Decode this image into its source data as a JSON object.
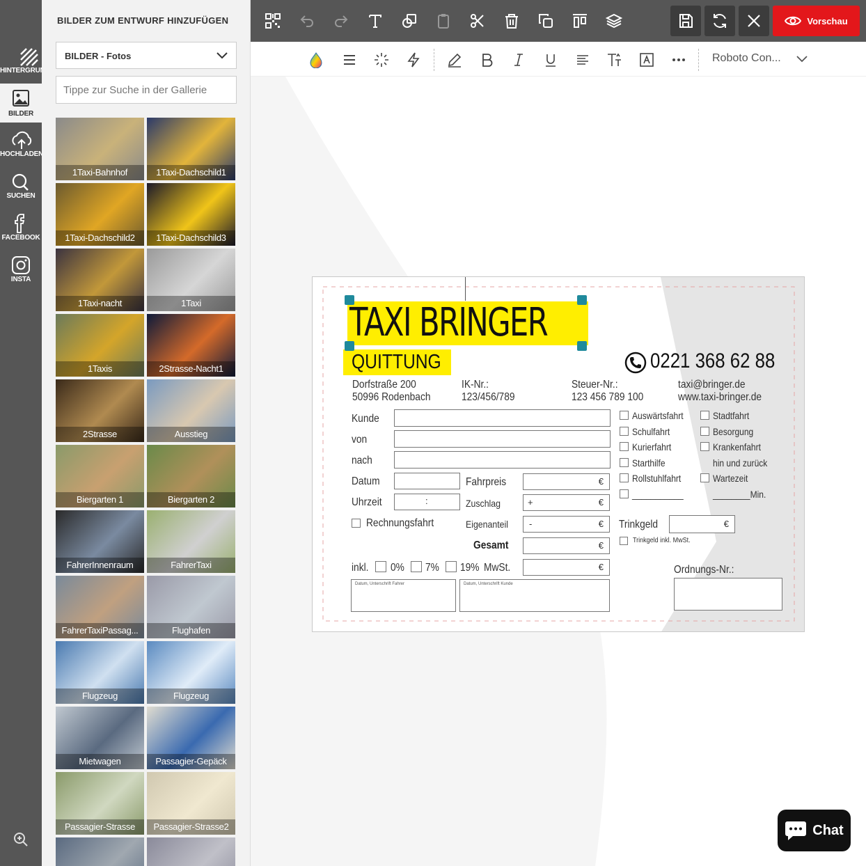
{
  "rail": {
    "items": [
      {
        "label": "HINTERGRUND",
        "icon": "background-stripes-icon"
      },
      {
        "label": "BILDER",
        "icon": "image-icon"
      },
      {
        "label": "HOCHLADEN",
        "icon": "cloud-upload-icon"
      },
      {
        "label": "SUCHEN",
        "icon": "search-icon"
      },
      {
        "label": "FACEBOOK",
        "icon": "facebook-icon"
      },
      {
        "label": "INSTA",
        "icon": "instagram-icon"
      }
    ]
  },
  "panel": {
    "title": "BILDER ZUM ENTWURF HINZUFÜGEN",
    "category_select": "BILDER - Fotos",
    "search_placeholder": "Tippe zur Suche in der Gallerie",
    "thumbnails": [
      "1Taxi-Bahnhof",
      "1Taxi-Dachschild1",
      "1Taxi-Dachschild2",
      "1Taxi-Dachschild3",
      "1Taxi-nacht",
      "1Taxi",
      "1Taxis",
      "2Strasse-Nacht1",
      "2Strasse",
      "Ausstieg",
      "Biergarten 1",
      "Biergarten 2",
      "FahrerInnenraum",
      "FahrerTaxi",
      "FahrerTaxiPassag...",
      "Flughafen",
      "Flugzeug",
      "Flugzeug",
      "Mietwagen",
      "Passagier-Gepäck",
      "Passagier-Strasse",
      "Passagier-Strasse2",
      "",
      ""
    ]
  },
  "toolbar": {
    "preview_label": "Vorschau",
    "font_name": "Roboto Con..."
  },
  "colors": {
    "rail_bg": "#565656",
    "accent_red": "#e3171b",
    "highlight_yellow": "#ffee00",
    "handle_teal": "#1f8a9c"
  },
  "card": {
    "company": "TAXI BRINGER",
    "subtitle": "QUITTUNG",
    "phone": "0221 368 62 88",
    "address_line1": "Dorfstraße 200",
    "address_line2": "50996 Rodenbach",
    "ik_label": "IK-Nr.:",
    "ik_value": "123/456/789",
    "tax_label": "Steuer-Nr.:",
    "tax_value": "123 456 789 100",
    "email": "taxi@bringer.de",
    "web": "www.taxi-bringer.de",
    "kunde": "Kunde",
    "von": "von",
    "nach": "nach",
    "datum": "Datum",
    "uhrzeit": "Uhrzeit",
    "uhrzeit_sep": ":",
    "rechnungsfahrt": "Rechnungsfahrt",
    "fahrpreis": "Fahrpreis",
    "zuschlag": "Zuschlag",
    "eigenanteil": "Eigenanteil",
    "gesamt": "Gesamt",
    "plus": "+",
    "minus": "-",
    "euro": "€",
    "inkl": "inkl.",
    "vat0": "0%",
    "vat7": "7%",
    "vat19": "19%",
    "mwst": "MwSt.",
    "sig_driver": "Datum, Unterschrift Fahrer",
    "sig_customer": "Datum, Unterschrift Kunde",
    "trinkgeld": "Trinkgeld",
    "trinkgeld_inkl": "Trinkgeld inkl. MwSt.",
    "ordnungs": "Ordnungs-Nr.:",
    "checks_left": [
      "Auswärtsfahrt",
      "Schulfahrt",
      "Kurierfahrt",
      "Starthilfe",
      "Rollstuhlfahrt",
      "___________"
    ],
    "checks_right": [
      "Stadtfahrt",
      "Besorgung",
      "Krankenfahrt",
      "hin und zurück",
      "Wartezeit",
      "________Min."
    ]
  },
  "chat": {
    "label": "Chat"
  }
}
